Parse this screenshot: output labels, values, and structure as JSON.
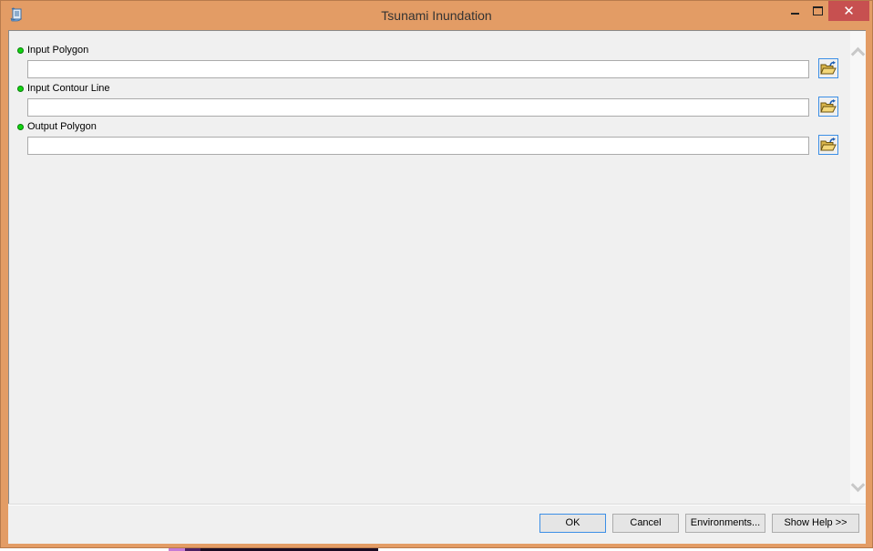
{
  "window": {
    "title": "Tsunami Inundation",
    "icon": "script-tool-icon",
    "controls": {
      "minimize": "minimize",
      "maximize": "maximize",
      "close": "✕"
    },
    "accent_color": "#e39c65",
    "close_color": "#c75050"
  },
  "parameters": [
    {
      "label": "Input Polygon",
      "value": "",
      "required": true,
      "browse_icon": "open-folder-icon"
    },
    {
      "label": "Input Contour Line",
      "value": "",
      "required": true,
      "browse_icon": "open-folder-icon"
    },
    {
      "label": "Output Polygon",
      "value": "",
      "required": true,
      "browse_icon": "open-folder-icon"
    }
  ],
  "footer": {
    "ok_label": "OK",
    "cancel_label": "Cancel",
    "environments_label": "Environments...",
    "show_help_label": "Show Help >>"
  }
}
